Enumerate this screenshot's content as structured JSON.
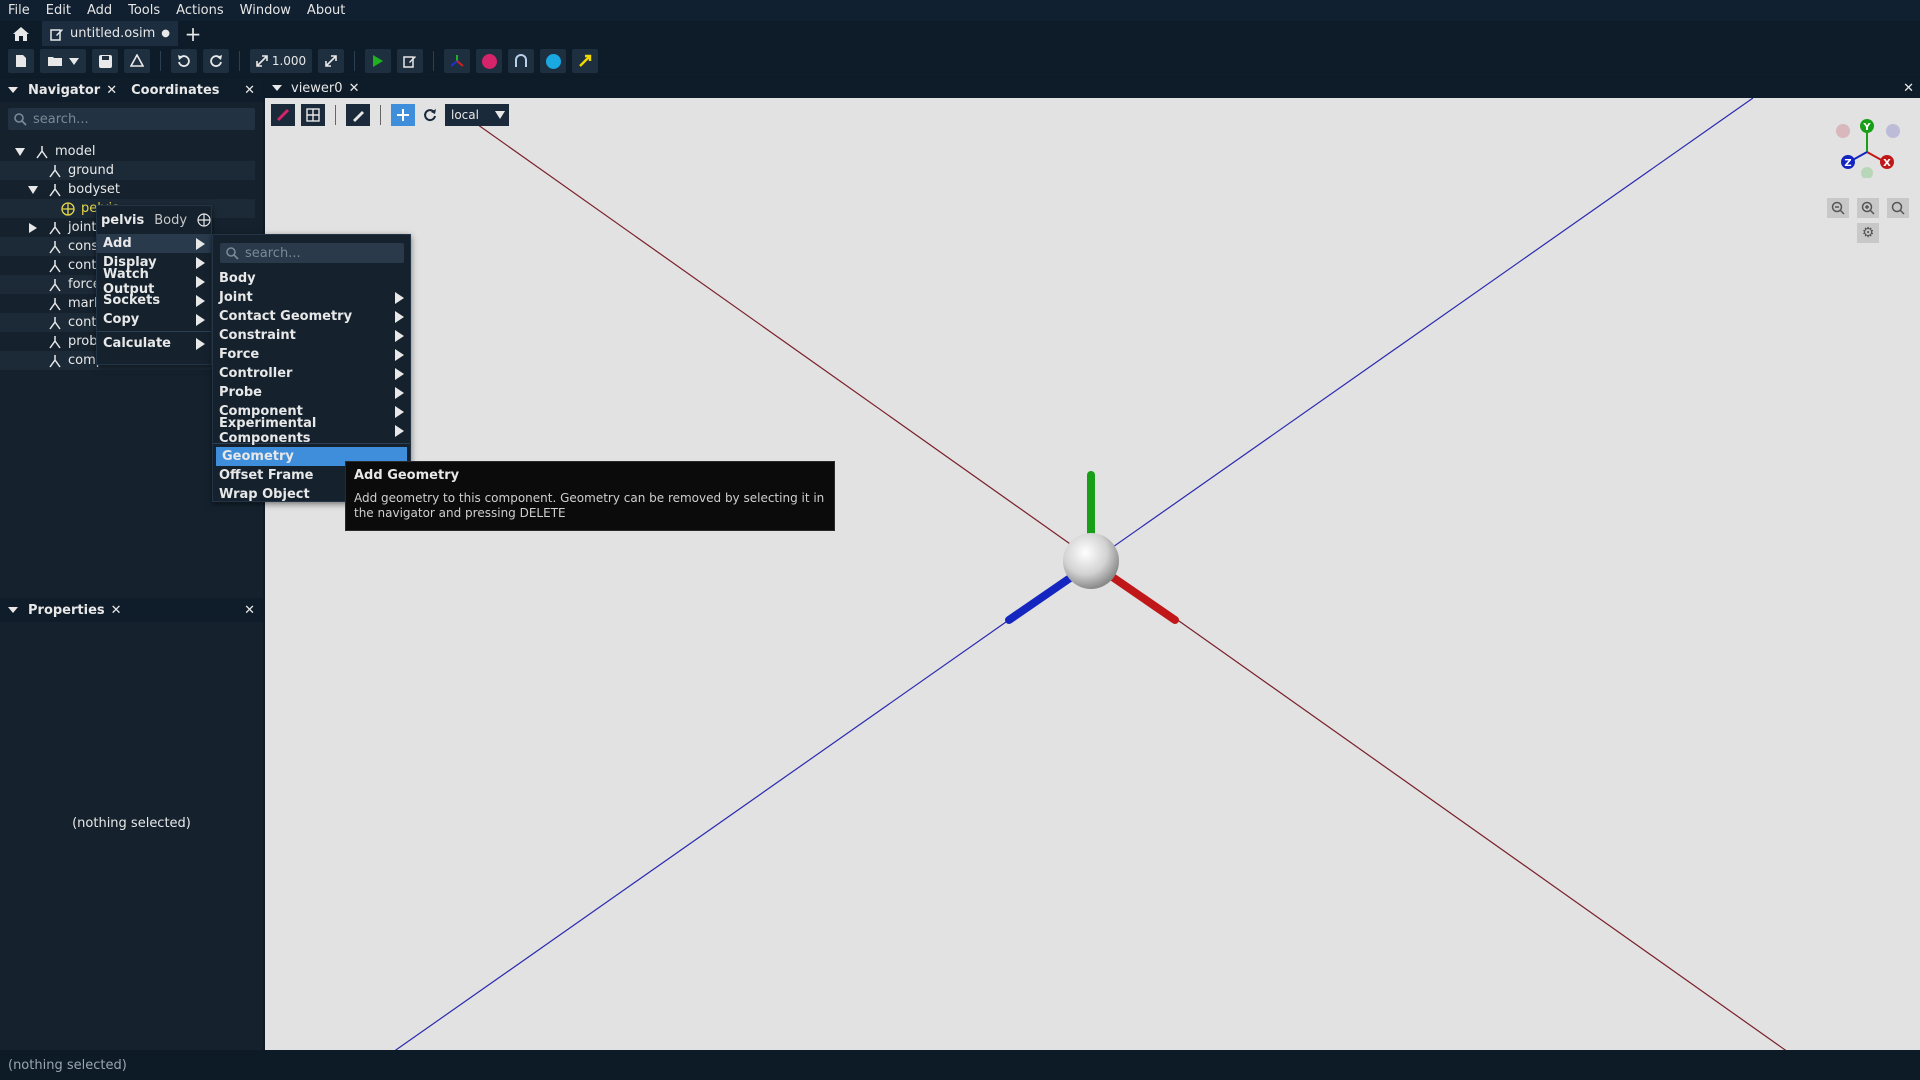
{
  "menubar": [
    "File",
    "Edit",
    "Add",
    "Tools",
    "Actions",
    "Window",
    "About"
  ],
  "tab": {
    "title": "untitled.osim",
    "modified_dot": "●",
    "new_tab": "+"
  },
  "toolbar": {
    "scale": "1.000"
  },
  "navigator": {
    "title": "Navigator",
    "coordinates_tab": "Coordinates",
    "search_placeholder": "search...",
    "tree": [
      {
        "label": "model"
      },
      {
        "label": "ground"
      },
      {
        "label": "bodyset"
      },
      {
        "label": "pelvis"
      },
      {
        "label": "jointset"
      },
      {
        "label": "constraintset"
      },
      {
        "label": "contactgeometryset"
      },
      {
        "label": "forceset"
      },
      {
        "label": "markerset"
      },
      {
        "label": "controllerset"
      },
      {
        "label": "probeset"
      },
      {
        "label": "componentset"
      }
    ]
  },
  "properties": {
    "title": "Properties",
    "empty_text": "(nothing selected)"
  },
  "viewer": {
    "title": "viewer0",
    "frame_mode": "local"
  },
  "context_menu": {
    "header_name": "pelvis",
    "header_type": "Body",
    "items": [
      "Add",
      "Display",
      "Watch Output",
      "Sockets",
      "Copy",
      "Calculate"
    ]
  },
  "add_submenu": {
    "search_placeholder": "search...",
    "items": [
      "Body",
      "Joint",
      "Contact Geometry",
      "Constraint",
      "Force",
      "Controller",
      "Probe",
      "Component",
      "Experimental Components",
      "Geometry",
      "Offset Frame",
      "Wrap Object"
    ]
  },
  "tooltip": {
    "title": "Add Geometry",
    "body": "Add geometry to this component. Geometry can be removed by selecting it in the navigator and pressing DELETE"
  },
  "gizmo": {
    "x": "X",
    "y": "Y",
    "z": "Z"
  },
  "status": {
    "text": "(nothing selected)"
  },
  "colors": {
    "accent": "#3f8edb",
    "x_axis": "#c01818",
    "y_axis": "#17a017",
    "z_axis": "#1525c0"
  }
}
